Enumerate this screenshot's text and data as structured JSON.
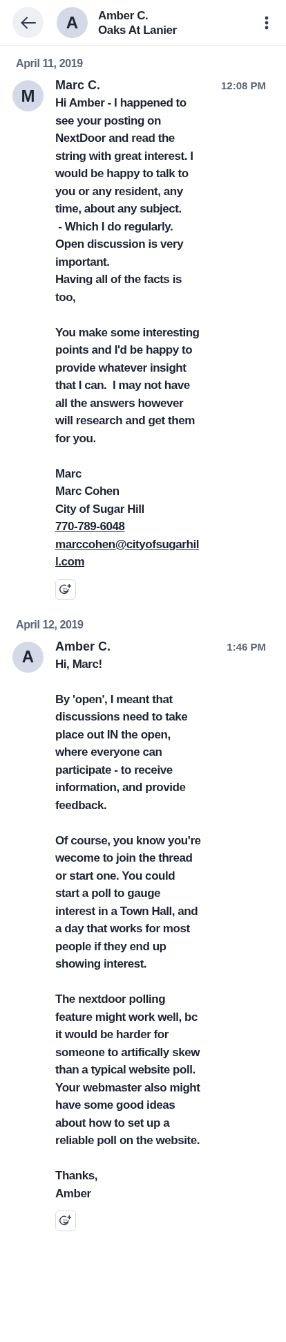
{
  "header": {
    "contact_initial": "A",
    "contact_name": "Amber C.",
    "contact_subtitle": "Oaks At Lanier"
  },
  "days": [
    {
      "date": "April 11, 2019",
      "messages": [
        {
          "initial": "M",
          "sender": "Marc C.",
          "time": "12:08 PM",
          "body": [
            {
              "kind": "text",
              "text": "Hi Amber - I happened to see your posting on NextDoor and read the string with great interest. I would be happy to talk to you or any resident, any time, about any subject.\n - Which I do regularly.\nOpen discussion is very important.\nHaving all of the facts is too,\n\nYou make some interesting points and I'd be happy to provide whatever insight that I can.  I may not have all the answers however will research and get them for you.\n\nMarc\nMarc Cohen\nCity of Sugar Hill"
            },
            {
              "kind": "link",
              "text": "770-789-6048"
            },
            {
              "kind": "link",
              "text": "marccohen@cityofsugarhill.com"
            }
          ]
        }
      ]
    },
    {
      "date": "April 12, 2019",
      "messages": [
        {
          "initial": "A",
          "sender": "Amber C.",
          "time": "1:46 PM",
          "body": [
            {
              "kind": "text",
              "text": "Hi, Marc!\n\nBy 'open', I meant that discussions need to take place out IN the open, where everyone can participate - to receive information, and provide feedback.\n\nOf course, you know you're wecome to join the thread or start one. You could start a poll to gauge interest in a Town Hall, and a day that works for most people if they end up showing interest.\n\nThe nextdoor polling feature might work well, bc it would be harder for someone to artifically skew than a typical website poll. Your webmaster also might have some good ideas about how to set up a reliable poll on the website.\n\nThanks,\nAmber"
            }
          ]
        }
      ]
    }
  ]
}
